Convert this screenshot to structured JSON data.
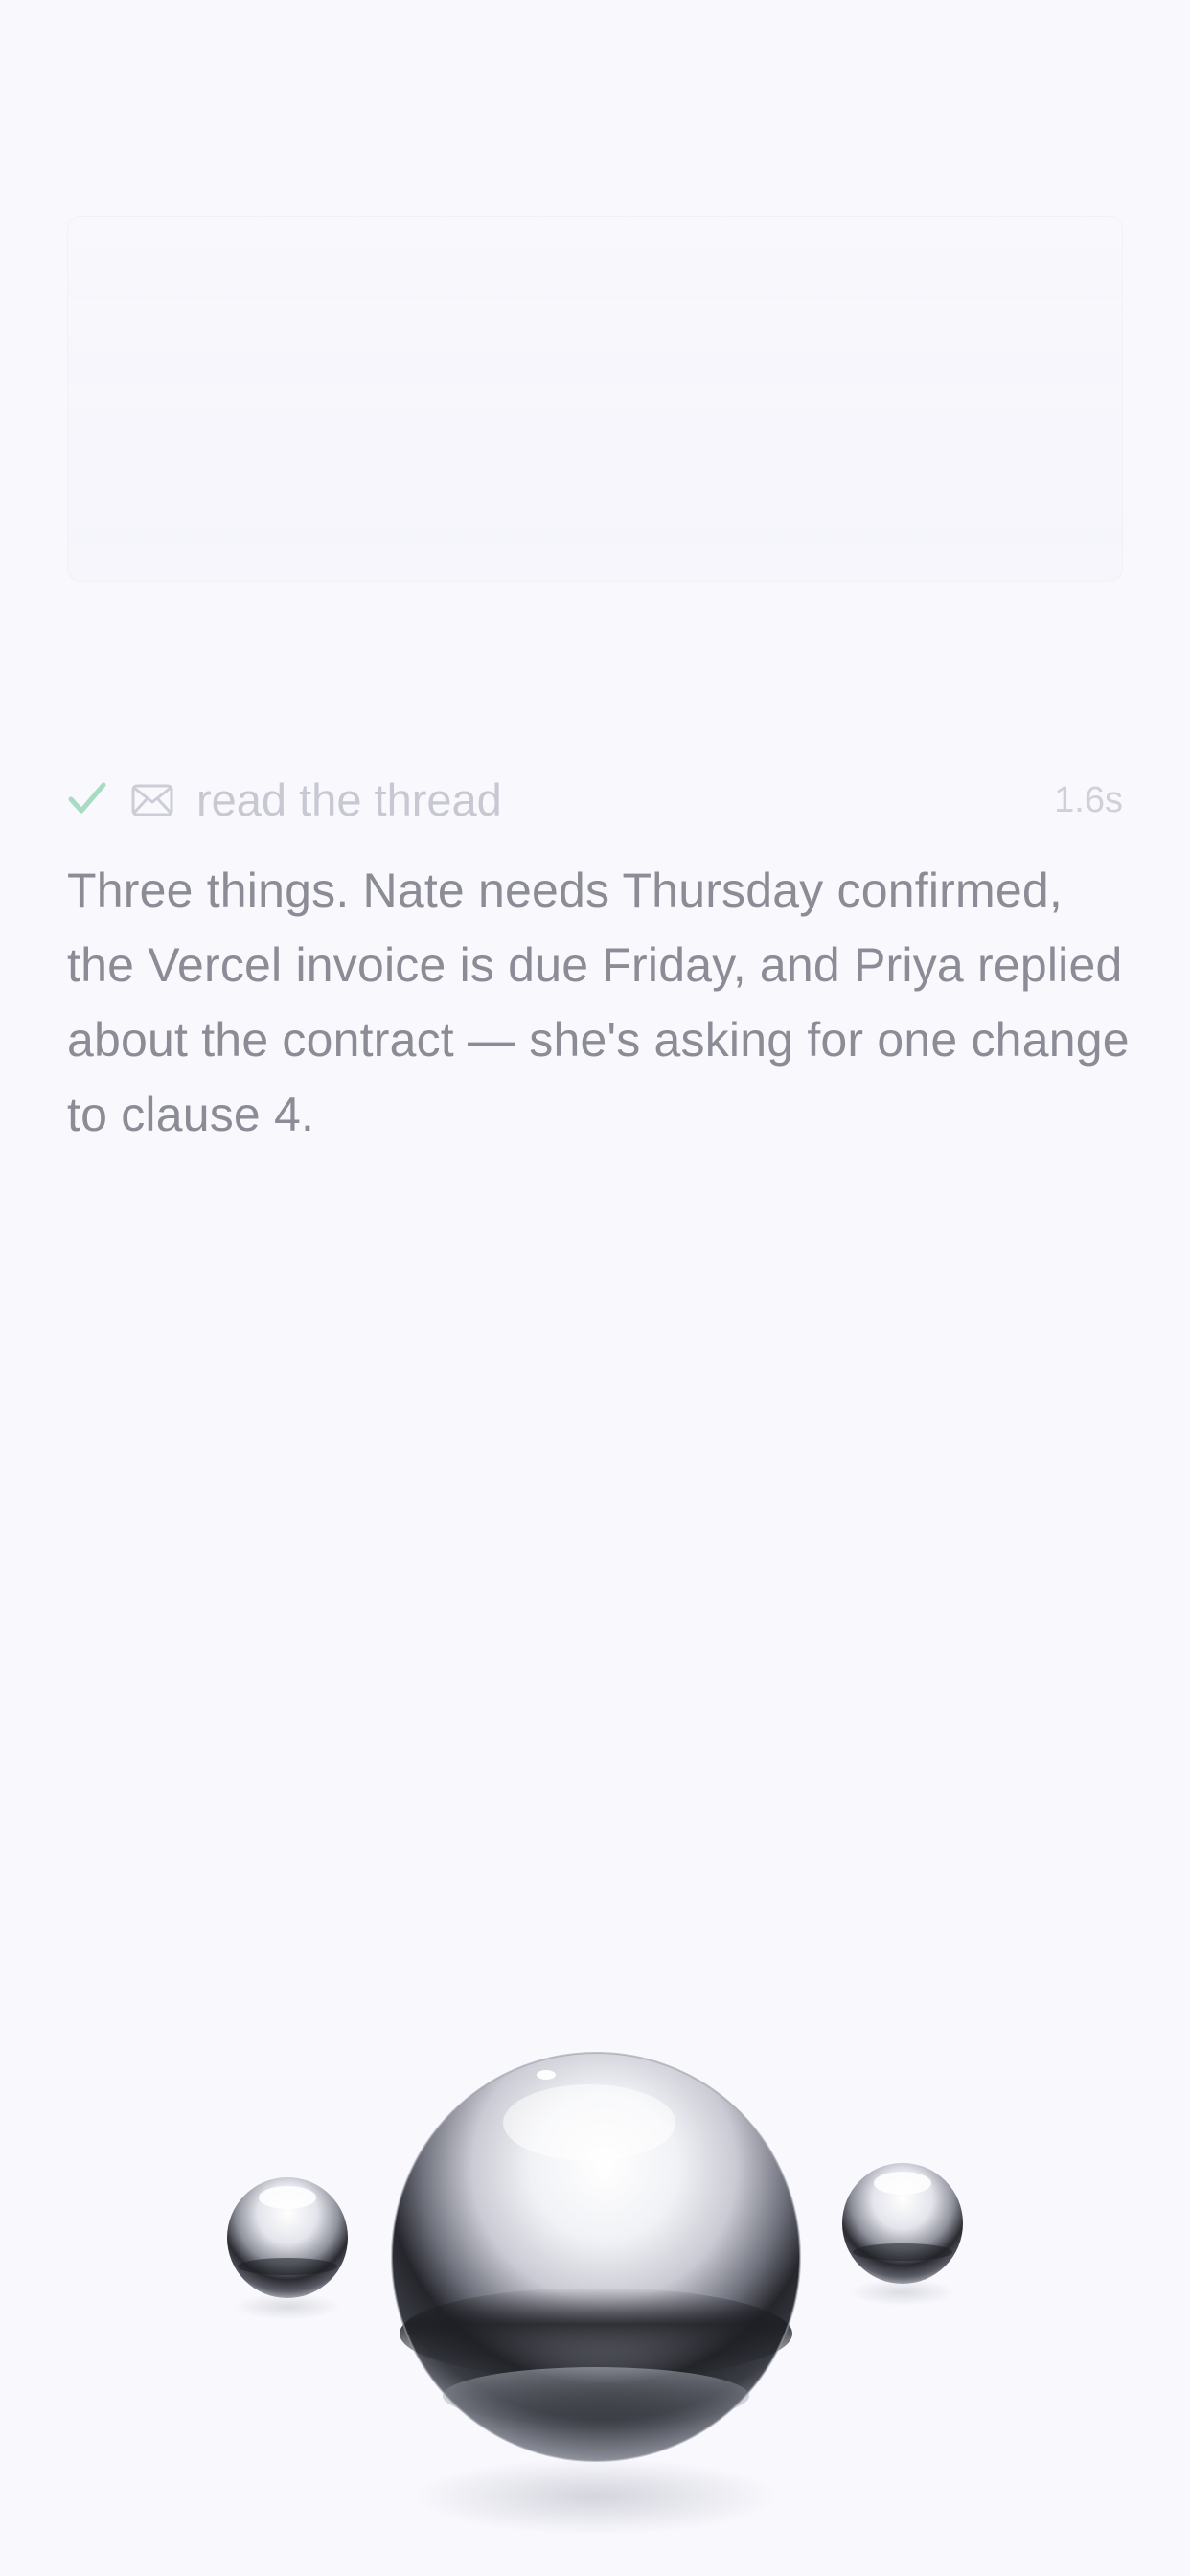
{
  "tool_call": {
    "status_icon": "check-icon",
    "tool_icon": "mail-icon",
    "label": "read the thread",
    "duration": "1.6s",
    "status_color": "#9fd9bd"
  },
  "assistant_reply": {
    "text": "Three things. Nate needs Thursday confirmed, the Vercel invoice is due Friday, and Priya replied about the contract — she's asking for one change to clause 4."
  },
  "voice_orbs": {
    "icons": [
      "small-orb-left",
      "main-orb",
      "small-orb-right"
    ]
  }
}
